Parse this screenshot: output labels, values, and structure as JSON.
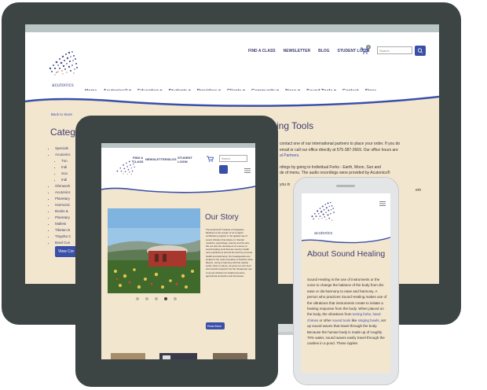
{
  "desktop": {
    "top_links": [
      "FIND A CLASS",
      "NEWSLETTER",
      "BLOG",
      "STUDENT LOGIN"
    ],
    "cart_count": "0",
    "search_placeholder": "Search",
    "logo_text": "acutonics",
    "nav": [
      "Home",
      "Acutonics® ▾",
      "Education ▾",
      "Students ▾",
      "Providers ▾",
      "Clients ▾",
      "Community ▾",
      "News ▾",
      "Sound Tools ▾",
      "Contact",
      "Store"
    ],
    "breadcrumb": "Back to Store",
    "categories_heading": "Catego",
    "categories": [
      "Specials",
      "Acutonics",
      "Tun",
      "Indi",
      "Sca",
      "Indi",
      "Ohmwork",
      "Acutonics",
      "Planetary",
      "Harmonic",
      "Books & ",
      "Planetary",
      "Mallets",
      "Tibetan B",
      "Tingsha C",
      "Bowl Cus"
    ],
    "view_button": "View Cor",
    "content_title": "ing Tools",
    "content_lines": [
      "contact one of our international partners to place your order. If you do",
      "email or call our office directly at 575-387-2669. Our office hours are",
      "al Partners.",
      "",
      "rdings by going to Individual Forks - Earth, Moon, Sun and",
      "de of menu. The audio recordings were provided by Acutonics®",
      "",
      "you in",
      "em"
    ]
  },
  "tablet": {
    "links": [
      "FIND A CLASS",
      "NEWSLETTER",
      "BLOG",
      "STUDENT LOGIN"
    ],
    "search_placeholder": "Search",
    "logo_text": "acutonics",
    "story_heading": "Our Story",
    "story_text": "The Acutonics® Institute of Integrative Medicine is the creator of an in-depth certification program in the applied use of sound vibration that draws on Oriental medicine, psychology, science and the arts. We are also the developers of a series of sound healing tools that are used by health care practitioners around the world to promote health and well-being. Our headquarters are located in the rural mountains of Northern New Mexico. Living in harmony with the natural world, close to nature, we grow our own food and conduct research into the therapeutic use of sound vibration for health promotion, agricultural production and processes.",
    "read_more": "Read More"
  },
  "phone": {
    "logo_text": "acutonics",
    "heading": "About Sound Healing",
    "text_parts": [
      "Sound Healing is the use of instruments or the voice to change the balance of the body from dis-ease or dis-harmony to ease and harmony. A person who practices Sound Healing makes use of the vibrations that instruments create to initiate a healing response from the body. When placed on the body, the vibrations from ",
      "tuning forks",
      ", ",
      "hand chimes",
      " or other ",
      "sound tools",
      " like ",
      "singing bowls",
      ", set up sound waves that travel through the body. Because the human body is made up of roughly 70% water, sound waves easily travel through the cavities in a pond. These ripples"
    ]
  },
  "colors": {
    "bezel": "#3c4544",
    "beige": "#f3e6cf",
    "accent_blue": "#3a4fa8",
    "nav_text": "#3d3d6e"
  }
}
